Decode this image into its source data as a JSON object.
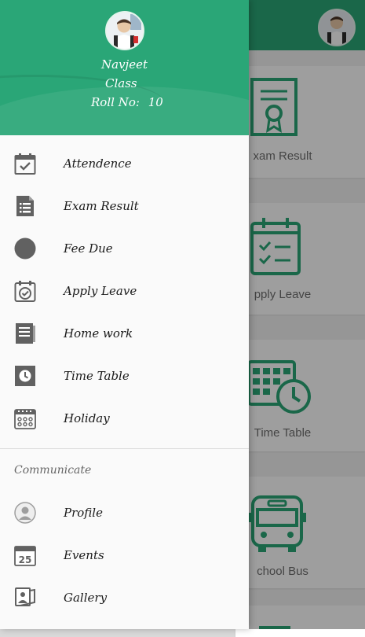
{
  "drawer": {
    "header": {
      "name": "Navjeet",
      "class_label": "Class",
      "roll_label": "Roll No:",
      "roll_value": "10"
    },
    "items": [
      {
        "label": "Attendence",
        "icon": "calendar-check-icon"
      },
      {
        "label": "Exam Result",
        "icon": "list-icon"
      },
      {
        "label": "Fee Due",
        "icon": "circle-icon"
      },
      {
        "label": "Apply Leave",
        "icon": "calendar-leave-icon"
      },
      {
        "label": "Home work",
        "icon": "book-icon"
      },
      {
        "label": "Time Table",
        "icon": "clock-icon"
      },
      {
        "label": "Holiday",
        "icon": "calendar-grid-icon"
      }
    ],
    "section_title": "Communicate",
    "communicate_items": [
      {
        "label": "Profile",
        "icon": "profile-icon"
      },
      {
        "label": "Events",
        "icon": "calendar-25-icon"
      },
      {
        "label": "Gallery",
        "icon": "gallery-icon"
      }
    ]
  },
  "background": {
    "tiles": [
      {
        "label": "xam Result",
        "icon": "certificate-icon"
      },
      {
        "label": "pply Leave",
        "icon": "calendar-check-icon"
      },
      {
        "label": "Time Table",
        "icon": "calendar-clock-icon"
      },
      {
        "label": "chool Bus",
        "icon": "bus-icon"
      }
    ]
  },
  "colors": {
    "primary": "#2aa677",
    "icon_grey": "#616161"
  }
}
